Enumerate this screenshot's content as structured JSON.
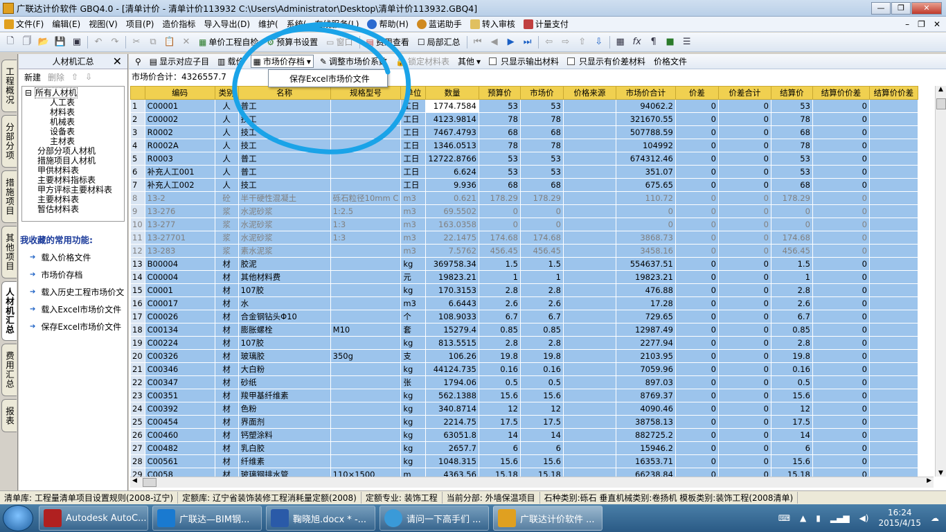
{
  "window": {
    "title": "广联达计价软件 GBQ4.0 - [清单计价 - 清单计价113932 C:\\Users\\Administrator\\Desktop\\清单计价113932.GBQ4]"
  },
  "menu": [
    "文件(F)",
    "编辑(E)",
    "视图(V)",
    "项目(P)",
    "造价指标",
    "导入导出(D)",
    "维护(",
    "系统(",
    "在线服务(L)",
    "帮助(H)",
    "蓝诺助手",
    "转入审核",
    "计量支付"
  ],
  "toolbar1": {
    "self_check": "单价工程自检",
    "budget_settings": "预算书设置",
    "window": "窗口",
    "fee_view": "费用查看",
    "partial_sum": "局部汇总"
  },
  "toolbar2": {
    "show_child": "显示对应子目",
    "price": "载价",
    "market_save": "市场价存档",
    "adjust": "调整市场价系数",
    "lock": "锁定材料表",
    "other": "其他",
    "only_output": "只显示输出材料",
    "only_diff": "只显示有价差材料",
    "price_file": "价格文件"
  },
  "popup": {
    "item": "保存Excel市场价文件"
  },
  "left_tabs": [
    "工程概况",
    "分部分项",
    "措施项目",
    "其他项目",
    "人材机汇总",
    "费用汇总",
    "报表"
  ],
  "panel": {
    "title": "人材机汇总",
    "new": "新建",
    "delete": "删除",
    "tree": [
      "所有人材机",
      "人工表",
      "材料表",
      "机械表",
      "设备表",
      "主材表",
      "分部分项人材机",
      "措施项目人材机",
      "甲供材料表",
      "主要材料指标表",
      "甲方评标主要材料表",
      "主要材料表",
      "暂估材料表"
    ],
    "fav_title": "我收藏的常用功能:",
    "favs": [
      "载入价格文件",
      "市场价存档",
      "载入历史工程市场价文",
      "载入Excel市场价文件",
      "保存Excel市场价文件"
    ]
  },
  "sum_line": "市场价合计：4326557.7",
  "table": {
    "headers": [
      "",
      "编码",
      "类别",
      "名称",
      "规格型号",
      "单位",
      "数量",
      "预算价",
      "市场价",
      "价格来源",
      "市场价合计",
      "价差",
      "价差合计",
      "结算价",
      "结算价价差",
      "结算价价差"
    ],
    "rows": [
      [
        "1",
        "C00001",
        "人",
        "普工",
        "",
        "工日",
        "1774.7584",
        "53",
        "53",
        "",
        "94062.2",
        "0",
        "0",
        "53",
        "0",
        ""
      ],
      [
        "2",
        "C00002",
        "人",
        "技工",
        "",
        "工日",
        "4123.9814",
        "78",
        "78",
        "",
        "321670.55",
        "0",
        "0",
        "78",
        "0",
        ""
      ],
      [
        "3",
        "R0002",
        "人",
        "技工",
        "",
        "工日",
        "7467.4793",
        "68",
        "68",
        "",
        "507788.59",
        "0",
        "0",
        "68",
        "0",
        ""
      ],
      [
        "4",
        "R0002A",
        "人",
        "技工",
        "",
        "工日",
        "1346.0513",
        "78",
        "78",
        "",
        "104992",
        "0",
        "0",
        "78",
        "0",
        ""
      ],
      [
        "5",
        "R0003",
        "人",
        "普工",
        "",
        "工日",
        "12722.8766",
        "53",
        "53",
        "",
        "674312.46",
        "0",
        "0",
        "53",
        "0",
        ""
      ],
      [
        "6",
        "补充人工001",
        "人",
        "普工",
        "",
        "工日",
        "6.624",
        "53",
        "53",
        "",
        "351.07",
        "0",
        "0",
        "53",
        "0",
        ""
      ],
      [
        "7",
        "补充人工002",
        "人",
        "技工",
        "",
        "工日",
        "9.936",
        "68",
        "68",
        "",
        "675.65",
        "0",
        "0",
        "68",
        "0",
        ""
      ],
      [
        "8",
        "13-2",
        "砼",
        "半干硬性混凝土",
        "砾石粒径10mm C",
        "m3",
        "0.621",
        "178.29",
        "178.29",
        "",
        "110.72",
        "0",
        "0",
        "178.29",
        "0",
        ""
      ],
      [
        "9",
        "13-276",
        "浆",
        "水泥砂浆",
        "1:2.5",
        "m3",
        "69.5502",
        "0",
        "0",
        "",
        "0",
        "0",
        "0",
        "0",
        "0",
        ""
      ],
      [
        "10",
        "13-277",
        "浆",
        "水泥砂浆",
        "1:3",
        "m3",
        "163.0358",
        "0",
        "0",
        "",
        "0",
        "0",
        "0",
        "0",
        "0",
        ""
      ],
      [
        "11",
        "13-27701",
        "浆",
        "水泥砂浆",
        "1:3",
        "m3",
        "22.1475",
        "174.68",
        "174.68",
        "",
        "3868.73",
        "0",
        "0",
        "174.68",
        "0",
        ""
      ],
      [
        "12",
        "13-283",
        "浆",
        "素水泥浆",
        "",
        "m3",
        "7.5762",
        "456.45",
        "456.45",
        "",
        "3458.16",
        "0",
        "0",
        "456.45",
        "0",
        ""
      ],
      [
        "13",
        "B00004",
        "材",
        "胶泥",
        "",
        "kg",
        "369758.34",
        "1.5",
        "1.5",
        "",
        "554637.51",
        "0",
        "0",
        "1.5",
        "0",
        ""
      ],
      [
        "14",
        "C00004",
        "材",
        "其他材料费",
        "",
        "元",
        "19823.21",
        "1",
        "1",
        "",
        "19823.21",
        "0",
        "0",
        "1",
        "0",
        ""
      ],
      [
        "15",
        "C0001",
        "材",
        "107胶",
        "",
        "kg",
        "170.3153",
        "2.8",
        "2.8",
        "",
        "476.88",
        "0",
        "0",
        "2.8",
        "0",
        ""
      ],
      [
        "16",
        "C00017",
        "材",
        "水",
        "",
        "m3",
        "6.6443",
        "2.6",
        "2.6",
        "",
        "17.28",
        "0",
        "0",
        "2.6",
        "0",
        ""
      ],
      [
        "17",
        "C00026",
        "材",
        "合金钢钻头Φ10",
        "",
        "个",
        "108.9033",
        "6.7",
        "6.7",
        "",
        "729.65",
        "0",
        "0",
        "6.7",
        "0",
        ""
      ],
      [
        "18",
        "C00134",
        "材",
        "膨胀螺栓",
        "M10",
        "套",
        "15279.4",
        "0.85",
        "0.85",
        "",
        "12987.49",
        "0",
        "0",
        "0.85",
        "0",
        ""
      ],
      [
        "19",
        "C00224",
        "材",
        "107胶",
        "",
        "kg",
        "813.5515",
        "2.8",
        "2.8",
        "",
        "2277.94",
        "0",
        "0",
        "2.8",
        "0",
        ""
      ],
      [
        "20",
        "C00326",
        "材",
        "玻璃胶",
        "350g",
        "支",
        "106.26",
        "19.8",
        "19.8",
        "",
        "2103.95",
        "0",
        "0",
        "19.8",
        "0",
        ""
      ],
      [
        "21",
        "C00346",
        "材",
        "大白粉",
        "",
        "kg",
        "44124.735",
        "0.16",
        "0.16",
        "",
        "7059.96",
        "0",
        "0",
        "0.16",
        "0",
        ""
      ],
      [
        "22",
        "C00347",
        "材",
        "砂纸",
        "",
        "张",
        "1794.06",
        "0.5",
        "0.5",
        "",
        "897.03",
        "0",
        "0",
        "0.5",
        "0",
        ""
      ],
      [
        "23",
        "C00351",
        "材",
        "羧甲基纤维素",
        "",
        "kg",
        "562.1388",
        "15.6",
        "15.6",
        "",
        "8769.37",
        "0",
        "0",
        "15.6",
        "0",
        ""
      ],
      [
        "24",
        "C00392",
        "材",
        "色粉",
        "",
        "kg",
        "340.8714",
        "12",
        "12",
        "",
        "4090.46",
        "0",
        "0",
        "12",
        "0",
        ""
      ],
      [
        "25",
        "C00454",
        "材",
        "界面剂",
        "",
        "kg",
        "2214.75",
        "17.5",
        "17.5",
        "",
        "38758.13",
        "0",
        "0",
        "17.5",
        "0",
        ""
      ],
      [
        "26",
        "C00460",
        "材",
        "钙塑涂料",
        "",
        "kg",
        "63051.8",
        "14",
        "14",
        "",
        "882725.2",
        "0",
        "0",
        "14",
        "0",
        ""
      ],
      [
        "27",
        "C00482",
        "材",
        "乳白胶",
        "",
        "kg",
        "2657.7",
        "6",
        "6",
        "",
        "15946.2",
        "0",
        "0",
        "6",
        "0",
        ""
      ],
      [
        "28",
        "C00561",
        "材",
        "纤维素",
        "",
        "kg",
        "1048.315",
        "15.6",
        "15.6",
        "",
        "16353.71",
        "0",
        "0",
        "15.6",
        "0",
        ""
      ],
      [
        "29",
        "C0058",
        "材",
        "玻璃钢排水管",
        "110×1500",
        "m",
        "4363.56",
        "15.18",
        "15.18",
        "",
        "66238.84",
        "0",
        "0",
        "15.18",
        "0",
        ""
      ]
    ]
  },
  "status": [
    "清单库: 工程量清单项目设置规则(2008-辽宁)",
    "定额库: 辽宁省装饰装修工程消耗量定额(2008)",
    "定额专业: 装饰工程",
    "当前分部: 外墙保温项目",
    "石种类别:砾石 垂直机械类别:卷扬机 模板类别:装饰工程(2008清单)"
  ],
  "taskbar": {
    "tasks": [
      "Autodesk AutoC...",
      "广联达—BIM钢...",
      "鞠晓旭.docx * -...",
      "请问一下高手们 ...",
      "广联达计价软件 ..."
    ],
    "time": "16:24",
    "date": "2015/4/15"
  },
  "colors": {
    "grid_row": "#9cc4ec",
    "header": "#f0d050",
    "annotation": "#1aa3e8"
  }
}
